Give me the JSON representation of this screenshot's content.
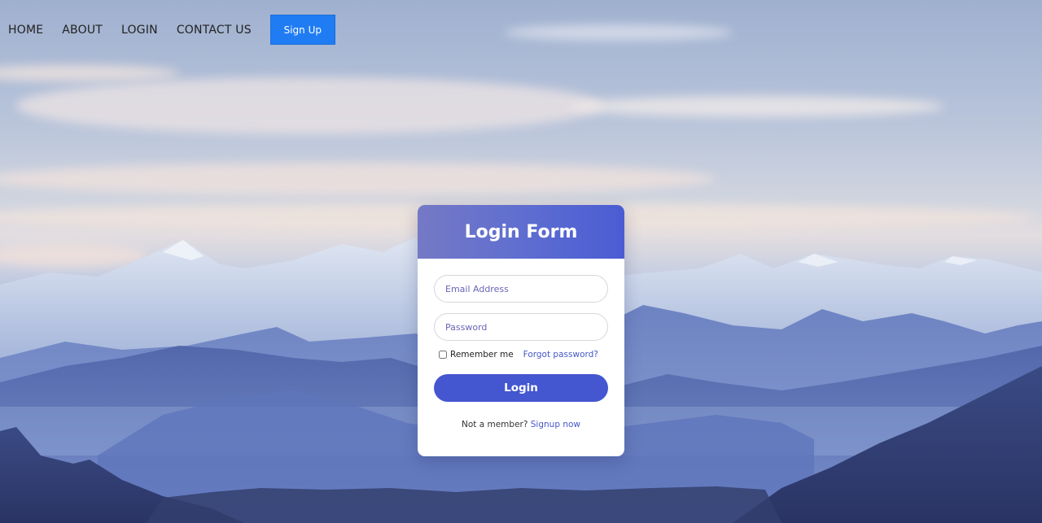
{
  "nav": {
    "items": [
      {
        "label": "HOME"
      },
      {
        "label": "ABOUT"
      },
      {
        "label": "LOGIN"
      },
      {
        "label": "CONTACT US"
      }
    ],
    "signup_button": "Sign Up"
  },
  "login_form": {
    "title": "Login Form",
    "email_placeholder": "Email Address",
    "password_placeholder": "Password",
    "remember_label": "Remember me",
    "remember_checked": false,
    "forgot_link": "Forgot password?",
    "submit_label": "Login",
    "signup_prompt": "Not a member?",
    "signup_link": "Signup now"
  },
  "colors": {
    "nav_button": "#1f7cf3",
    "header_gradient_start": "#7579c5",
    "header_gradient_end": "#4a5cd3",
    "login_button": "#4456d0",
    "link": "#4557c8"
  },
  "background": {
    "scene": "mountain-landscape-image"
  }
}
